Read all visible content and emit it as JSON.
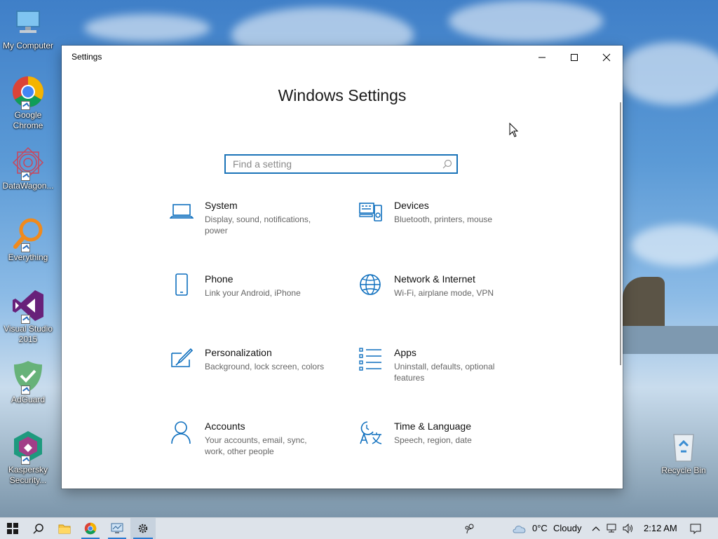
{
  "desktop": {
    "icons": [
      {
        "label": "My Computer"
      },
      {
        "label": "Google Chrome"
      },
      {
        "label": "DataWagon..."
      },
      {
        "label": "Everything"
      },
      {
        "label": "Visual Studio 2015"
      },
      {
        "label": "AdGuard"
      },
      {
        "label": "Kaspersky Security..."
      },
      {
        "label": "Recycle Bin"
      }
    ]
  },
  "window": {
    "title": "Settings",
    "heading": "Windows Settings",
    "search_placeholder": "Find a setting",
    "tiles": [
      {
        "name": "System",
        "desc": "Display, sound, notifications, power",
        "icon": "laptop-icon"
      },
      {
        "name": "Devices",
        "desc": "Bluetooth, printers, mouse",
        "icon": "devices-icon"
      },
      {
        "name": "Phone",
        "desc": "Link your Android, iPhone",
        "icon": "phone-icon"
      },
      {
        "name": "Network & Internet",
        "desc": "Wi-Fi, airplane mode, VPN",
        "icon": "globe-icon"
      },
      {
        "name": "Personalization",
        "desc": "Background, lock screen, colors",
        "icon": "paint-icon"
      },
      {
        "name": "Apps",
        "desc": "Uninstall, defaults, optional features",
        "icon": "apps-list-icon"
      },
      {
        "name": "Accounts",
        "desc": "Your accounts, email, sync, work, other people",
        "icon": "person-icon"
      },
      {
        "name": "Time & Language",
        "desc": "Speech, region, date",
        "icon": "time-language-icon"
      }
    ]
  },
  "taskbar": {
    "weather_temp": "0°C",
    "weather_text": "Cloudy",
    "time": "2:12 AM"
  },
  "colors": {
    "accent": "#1a73b8",
    "icon_blue": "#0e6fbe"
  }
}
